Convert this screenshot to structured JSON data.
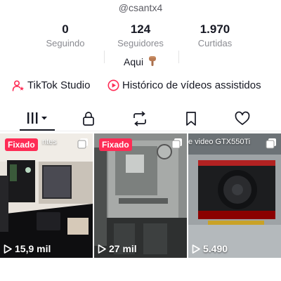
{
  "profile": {
    "username": "@csantx4",
    "bio": "Aqui"
  },
  "stats": [
    {
      "value": "0",
      "label": "Seguindo"
    },
    {
      "value": "124",
      "label": "Seguidores"
    },
    {
      "value": "1.970",
      "label": "Curtidas"
    }
  ],
  "links": {
    "studio": "TikTok Studio",
    "history": "Histórico de vídeos assistidos"
  },
  "tabs": [
    {
      "icon": "grid-icon",
      "selected": true
    },
    {
      "icon": "lock-icon",
      "selected": false
    },
    {
      "icon": "repost-icon",
      "selected": false
    },
    {
      "icon": "bookmark-icon",
      "selected": false
    },
    {
      "icon": "heart-icon",
      "selected": false
    }
  ],
  "videos": [
    {
      "pinned_label": "Fixado",
      "overlay_text": "ntes",
      "views": "15,9 mil"
    },
    {
      "pinned_label": "Fixado",
      "overlay_text": "",
      "views": "27 mil"
    },
    {
      "pinned_label": "",
      "overlay_text": "e video GTX550Ti",
      "views": "5.490"
    }
  ],
  "colors": {
    "accent": "#fe2c55",
    "text_primary": "#161823",
    "text_secondary": "#8a8b91"
  }
}
